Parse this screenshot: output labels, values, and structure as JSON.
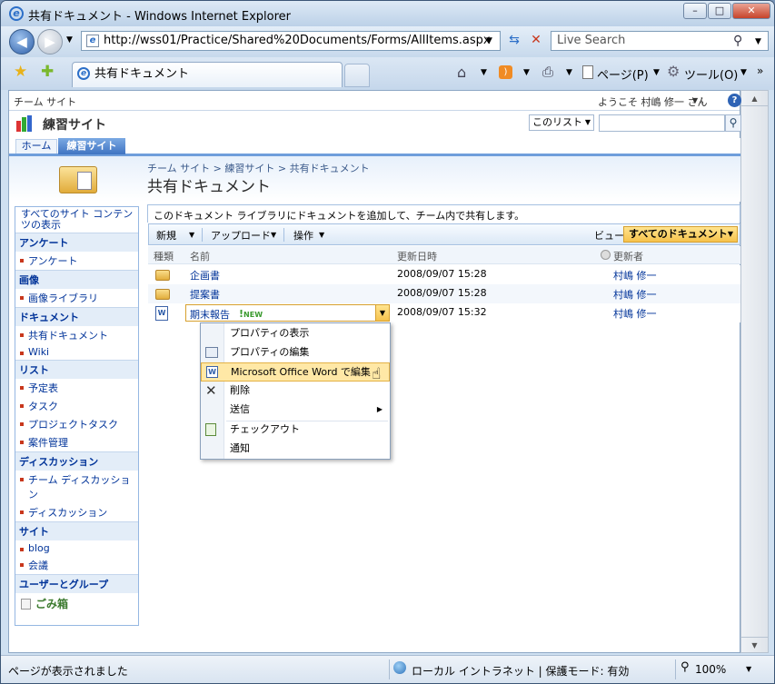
{
  "window": {
    "title": "共有ドキュメント - Windows Internet Explorer"
  },
  "browser": {
    "address": "http://wss01/Practice/Shared%20Documents/Forms/AllItems.aspx",
    "search_placeholder": "Live Search",
    "tab_title": "共有ドキュメント",
    "cmd_page": "ページ(P)",
    "cmd_tools": "ツール(O)"
  },
  "sp": {
    "team_site": "チーム サイト",
    "welcome": "ようこそ 村嶋 修一 さん",
    "site_name": "練習サイト",
    "scope": "このリスト",
    "tab_home": "ホーム",
    "tab_site": "練習サイト",
    "breadcrumb": "チーム サイト > 練習サイト > 共有ドキュメント",
    "page_title": "共有ドキュメント",
    "description": "このドキュメント ライブラリにドキュメントを追加して、チーム内で共有します。"
  },
  "quicklaunch": {
    "all": "すべてのサイト コンテンツの表示",
    "sections": [
      {
        "title": "アンケート",
        "items": [
          "アンケート"
        ]
      },
      {
        "title": "画像",
        "items": [
          "画像ライブラリ"
        ]
      },
      {
        "title": "ドキュメント",
        "items": [
          "共有ドキュメント",
          "Wiki"
        ]
      },
      {
        "title": "リスト",
        "items": [
          "予定表",
          "タスク",
          "プロジェクトタスク",
          "案件管理"
        ]
      },
      {
        "title": "ディスカッション",
        "items": [
          "チーム ディスカッション",
          "ディスカッション"
        ]
      },
      {
        "title": "サイト",
        "items": [
          "blog",
          "会議"
        ]
      },
      {
        "title": "ユーザーとグループ",
        "items": []
      }
    ],
    "recycle": "ごみ箱"
  },
  "toolbar": {
    "new": "新規",
    "upload": "アップロード",
    "actions": "操作",
    "view_label": "ビュー:",
    "view_value": "すべてのドキュメント"
  },
  "columns": {
    "type": "種類",
    "name": "名前",
    "modified": "更新日時",
    "modified_by": "更新者"
  },
  "rows": [
    {
      "name": "企画書",
      "modified": "2008/09/07 15:28",
      "by": "村嶋 修一"
    },
    {
      "name": "提案書",
      "modified": "2008/09/07 15:28",
      "by": "村嶋 修一"
    },
    {
      "name": "期末報告",
      "new": "NEW",
      "modified": "2008/09/07 15:32",
      "by": "村嶋 修一"
    }
  ],
  "context_menu": [
    "プロパティの表示",
    "プロパティの編集",
    "Microsoft Office Word で編集",
    "削除",
    "送信",
    "チェックアウト",
    "通知"
  ],
  "statusbar": {
    "left": "ページが表示されました",
    "zone": "ローカル イントラネット | 保護モード: 有効",
    "zoom": "100%"
  }
}
